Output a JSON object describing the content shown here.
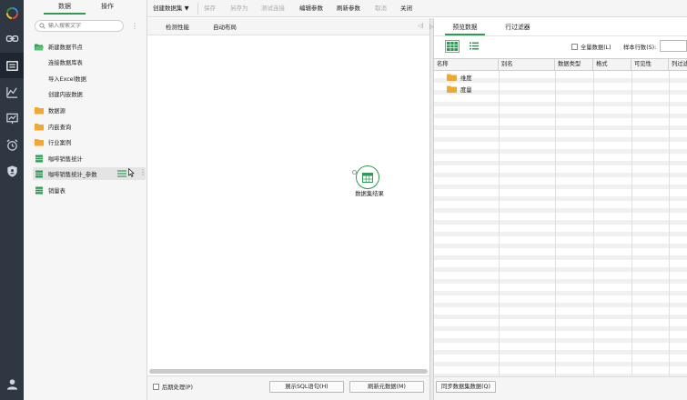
{
  "panel_tabs": {
    "data": "数据",
    "ops": "操作"
  },
  "search": {
    "placeholder": "输入搜索文字"
  },
  "tree": {
    "new_node": "新建数据节点",
    "connect_db": "连接数据库表",
    "import_excel": "导入Excel数据",
    "create_inline": "创建内嵌数据",
    "folder_data": "数据源",
    "folder_inline_query": "内嵌查询",
    "folder_industry": "行业案例",
    "coffee_sales": "咖啡销售统计",
    "coffee_sales_param": "咖啡销售统计_参数",
    "sales_table": "销量表"
  },
  "toolbar": {
    "create_dataset": "创建数据集 ▼",
    "save": "保存",
    "save_as": "另存为",
    "test_connection": "测试连接",
    "edit_params": "编辑参数",
    "refresh_params": "刷新参数",
    "cancel": "取消",
    "close": "关闭"
  },
  "canvas": {
    "check_validity": "检测性能",
    "auto_layout": "自动布局",
    "node_label": "数据集结果",
    "post_process_label": "后期处理(P)",
    "show_sql": "展示SQL语句(H)",
    "refresh_metadata": "刷新元数据(M)"
  },
  "preview": {
    "tab_preview": "预览数据",
    "tab_row_filter": "行过滤器",
    "full_data_label": "全量数据(L)",
    "sample_rows_label": "样本行数(S):",
    "columns": [
      "名称",
      "别名",
      "数据类型",
      "格式",
      "可见性",
      "列过滤"
    ],
    "rows": [
      "维度",
      "度量"
    ],
    "sync_button": "同步数据集数据(Q)"
  },
  "colors": {
    "accent": "#2e9a54",
    "rail": "#2f3842",
    "folder": "#f0a830"
  }
}
